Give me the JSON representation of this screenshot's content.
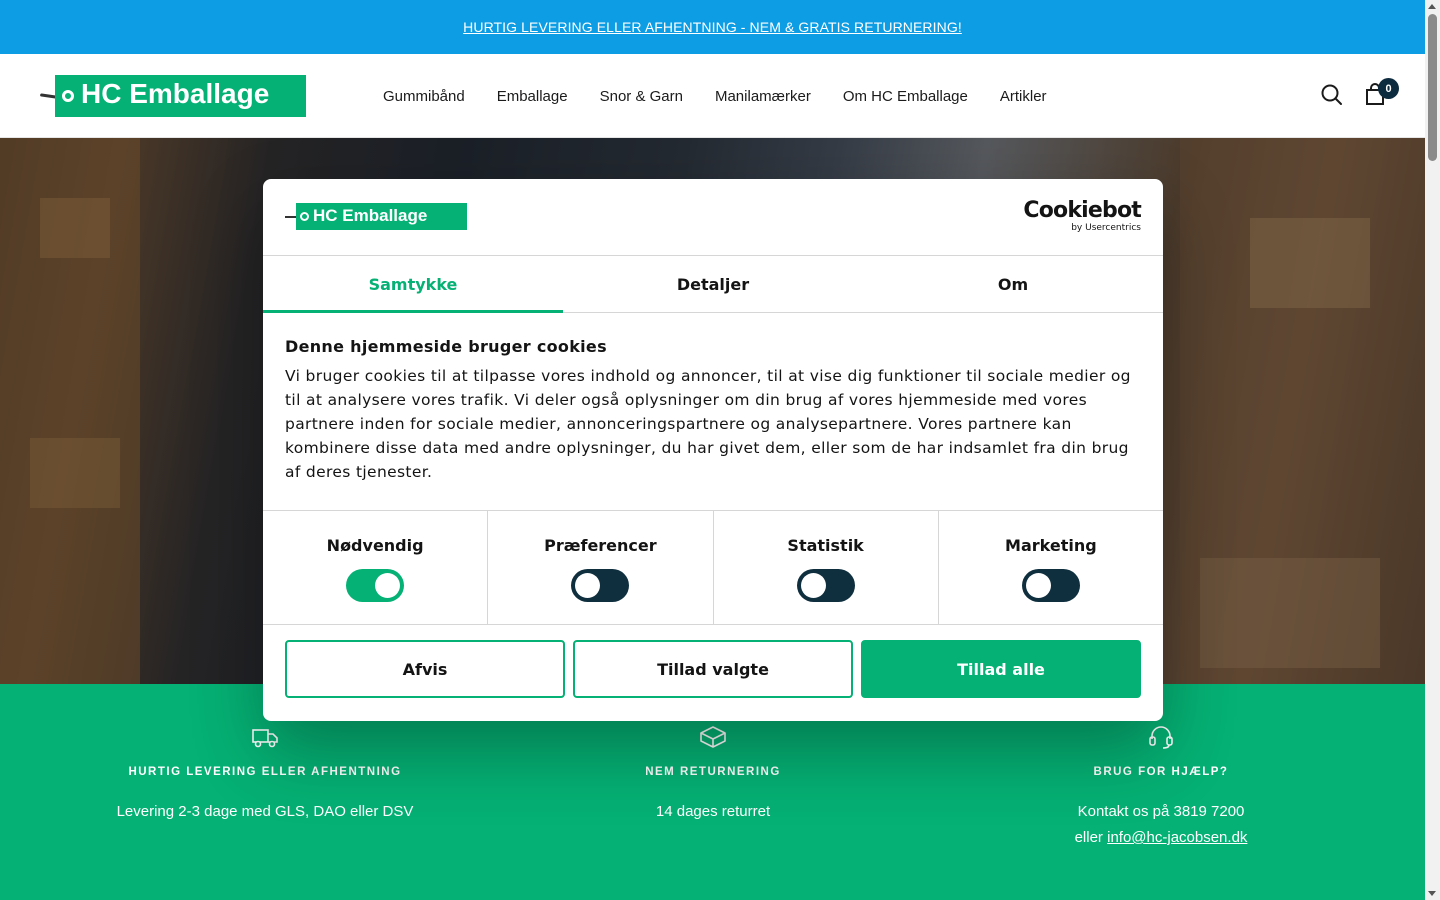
{
  "announcement": {
    "text": "HURTIG LEVERING ELLER AFHENTNING - NEM & GRATIS RETURNERING!"
  },
  "header": {
    "logo_text": "HC Emballage",
    "nav": [
      "Gummibånd",
      "Emballage",
      "Snor & Garn",
      "Manilamærker",
      "Om HC Emballage",
      "Artikler"
    ],
    "cart_count": "0",
    "icons": {
      "search": "search-icon",
      "cart": "cart-icon"
    }
  },
  "features": [
    {
      "icon": "truck-icon",
      "title": "HURTIG LEVERING ELLER AFHENTNING",
      "text": "Levering 2-3 dage med GLS, DAO eller DSV"
    },
    {
      "icon": "box-icon",
      "title": "NEM RETURNERING",
      "text": "14 dages returret"
    },
    {
      "icon": "headset-icon",
      "title": "BRUG FOR HJÆLP?",
      "text": "Kontakt os på 3819 7200",
      "text2_prefix": "eller",
      "email": "info@hc-jacobsen.dk"
    }
  ],
  "cookie_dialog": {
    "logo_text": "HC Emballage",
    "brand": "Cookiebot",
    "brand_sub": "by Usercentrics",
    "tabs": [
      "Samtykke",
      "Detaljer",
      "Om"
    ],
    "active_tab": "Samtykke",
    "heading": "Denne hjemmeside bruger cookies",
    "body": "Vi bruger cookies til at tilpasse vores indhold og annoncer, til at vise dig funktioner til sociale medier og til at analysere vores trafik. Vi deler også oplysninger om din brug af vores hjemmeside med vores partnere inden for sociale medier, annonceringspartnere og analysepartnere. Vores partnere kan kombinere disse data med andre oplysninger, du har givet dem, eller som de har indsamlet fra din brug af deres tjenester.",
    "categories": [
      {
        "label": "Nødvendig",
        "enabled": true
      },
      {
        "label": "Præferencer",
        "enabled": false
      },
      {
        "label": "Statistik",
        "enabled": false
      },
      {
        "label": "Marketing",
        "enabled": false
      }
    ],
    "buttons": {
      "deny": "Afvis",
      "allow_selected": "Tillad valgte",
      "allow_all": "Tillad alle"
    }
  },
  "colors": {
    "accent": "#05b174",
    "announcement": "#0d9de5",
    "dark": "#0f2f3f"
  }
}
